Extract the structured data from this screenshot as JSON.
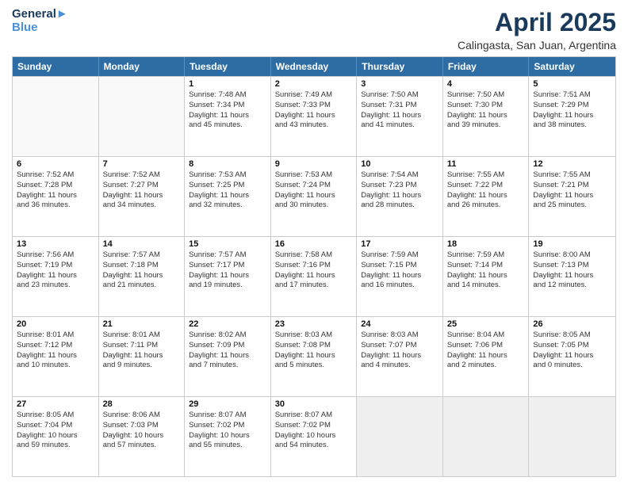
{
  "logo": {
    "line1": "General",
    "line2": "Blue"
  },
  "title": "April 2025",
  "subtitle": "Calingasta, San Juan, Argentina",
  "days_of_week": [
    "Sunday",
    "Monday",
    "Tuesday",
    "Wednesday",
    "Thursday",
    "Friday",
    "Saturday"
  ],
  "weeks": [
    [
      {
        "day": "",
        "lines": [],
        "empty": true
      },
      {
        "day": "",
        "lines": [],
        "empty": true
      },
      {
        "day": "1",
        "lines": [
          "Sunrise: 7:48 AM",
          "Sunset: 7:34 PM",
          "Daylight: 11 hours",
          "and 45 minutes."
        ]
      },
      {
        "day": "2",
        "lines": [
          "Sunrise: 7:49 AM",
          "Sunset: 7:33 PM",
          "Daylight: 11 hours",
          "and 43 minutes."
        ]
      },
      {
        "day": "3",
        "lines": [
          "Sunrise: 7:50 AM",
          "Sunset: 7:31 PM",
          "Daylight: 11 hours",
          "and 41 minutes."
        ]
      },
      {
        "day": "4",
        "lines": [
          "Sunrise: 7:50 AM",
          "Sunset: 7:30 PM",
          "Daylight: 11 hours",
          "and 39 minutes."
        ]
      },
      {
        "day": "5",
        "lines": [
          "Sunrise: 7:51 AM",
          "Sunset: 7:29 PM",
          "Daylight: 11 hours",
          "and 38 minutes."
        ]
      }
    ],
    [
      {
        "day": "6",
        "lines": [
          "Sunrise: 7:52 AM",
          "Sunset: 7:28 PM",
          "Daylight: 11 hours",
          "and 36 minutes."
        ]
      },
      {
        "day": "7",
        "lines": [
          "Sunrise: 7:52 AM",
          "Sunset: 7:27 PM",
          "Daylight: 11 hours",
          "and 34 minutes."
        ]
      },
      {
        "day": "8",
        "lines": [
          "Sunrise: 7:53 AM",
          "Sunset: 7:25 PM",
          "Daylight: 11 hours",
          "and 32 minutes."
        ]
      },
      {
        "day": "9",
        "lines": [
          "Sunrise: 7:53 AM",
          "Sunset: 7:24 PM",
          "Daylight: 11 hours",
          "and 30 minutes."
        ]
      },
      {
        "day": "10",
        "lines": [
          "Sunrise: 7:54 AM",
          "Sunset: 7:23 PM",
          "Daylight: 11 hours",
          "and 28 minutes."
        ]
      },
      {
        "day": "11",
        "lines": [
          "Sunrise: 7:55 AM",
          "Sunset: 7:22 PM",
          "Daylight: 11 hours",
          "and 26 minutes."
        ]
      },
      {
        "day": "12",
        "lines": [
          "Sunrise: 7:55 AM",
          "Sunset: 7:21 PM",
          "Daylight: 11 hours",
          "and 25 minutes."
        ]
      }
    ],
    [
      {
        "day": "13",
        "lines": [
          "Sunrise: 7:56 AM",
          "Sunset: 7:19 PM",
          "Daylight: 11 hours",
          "and 23 minutes."
        ]
      },
      {
        "day": "14",
        "lines": [
          "Sunrise: 7:57 AM",
          "Sunset: 7:18 PM",
          "Daylight: 11 hours",
          "and 21 minutes."
        ]
      },
      {
        "day": "15",
        "lines": [
          "Sunrise: 7:57 AM",
          "Sunset: 7:17 PM",
          "Daylight: 11 hours",
          "and 19 minutes."
        ]
      },
      {
        "day": "16",
        "lines": [
          "Sunrise: 7:58 AM",
          "Sunset: 7:16 PM",
          "Daylight: 11 hours",
          "and 17 minutes."
        ]
      },
      {
        "day": "17",
        "lines": [
          "Sunrise: 7:59 AM",
          "Sunset: 7:15 PM",
          "Daylight: 11 hours",
          "and 16 minutes."
        ]
      },
      {
        "day": "18",
        "lines": [
          "Sunrise: 7:59 AM",
          "Sunset: 7:14 PM",
          "Daylight: 11 hours",
          "and 14 minutes."
        ]
      },
      {
        "day": "19",
        "lines": [
          "Sunrise: 8:00 AM",
          "Sunset: 7:13 PM",
          "Daylight: 11 hours",
          "and 12 minutes."
        ]
      }
    ],
    [
      {
        "day": "20",
        "lines": [
          "Sunrise: 8:01 AM",
          "Sunset: 7:12 PM",
          "Daylight: 11 hours",
          "and 10 minutes."
        ]
      },
      {
        "day": "21",
        "lines": [
          "Sunrise: 8:01 AM",
          "Sunset: 7:11 PM",
          "Daylight: 11 hours",
          "and 9 minutes."
        ]
      },
      {
        "day": "22",
        "lines": [
          "Sunrise: 8:02 AM",
          "Sunset: 7:09 PM",
          "Daylight: 11 hours",
          "and 7 minutes."
        ]
      },
      {
        "day": "23",
        "lines": [
          "Sunrise: 8:03 AM",
          "Sunset: 7:08 PM",
          "Daylight: 11 hours",
          "and 5 minutes."
        ]
      },
      {
        "day": "24",
        "lines": [
          "Sunrise: 8:03 AM",
          "Sunset: 7:07 PM",
          "Daylight: 11 hours",
          "and 4 minutes."
        ]
      },
      {
        "day": "25",
        "lines": [
          "Sunrise: 8:04 AM",
          "Sunset: 7:06 PM",
          "Daylight: 11 hours",
          "and 2 minutes."
        ]
      },
      {
        "day": "26",
        "lines": [
          "Sunrise: 8:05 AM",
          "Sunset: 7:05 PM",
          "Daylight: 11 hours",
          "and 0 minutes."
        ]
      }
    ],
    [
      {
        "day": "27",
        "lines": [
          "Sunrise: 8:05 AM",
          "Sunset: 7:04 PM",
          "Daylight: 10 hours",
          "and 59 minutes."
        ]
      },
      {
        "day": "28",
        "lines": [
          "Sunrise: 8:06 AM",
          "Sunset: 7:03 PM",
          "Daylight: 10 hours",
          "and 57 minutes."
        ]
      },
      {
        "day": "29",
        "lines": [
          "Sunrise: 8:07 AM",
          "Sunset: 7:02 PM",
          "Daylight: 10 hours",
          "and 55 minutes."
        ]
      },
      {
        "day": "30",
        "lines": [
          "Sunrise: 8:07 AM",
          "Sunset: 7:02 PM",
          "Daylight: 10 hours",
          "and 54 minutes."
        ]
      },
      {
        "day": "",
        "lines": [],
        "empty": true,
        "shaded": true
      },
      {
        "day": "",
        "lines": [],
        "empty": true,
        "shaded": true
      },
      {
        "day": "",
        "lines": [],
        "empty": true,
        "shaded": true
      }
    ]
  ]
}
